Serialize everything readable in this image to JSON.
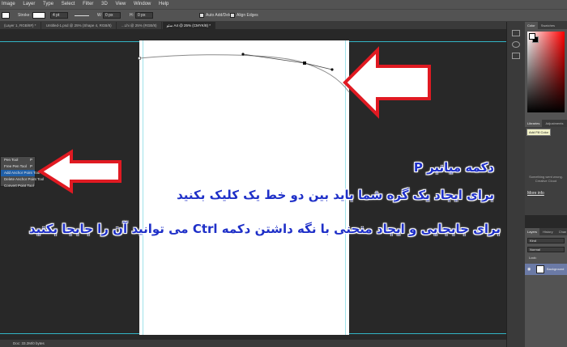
{
  "menu": [
    "Image",
    "Layer",
    "Type",
    "Select",
    "Filter",
    "3D",
    "View",
    "Window",
    "Help"
  ],
  "options_bar": {
    "stroke_label": "Stroke:",
    "stroke_width": "4 pt",
    "w_label": "W:",
    "w_value": "0 px",
    "h_label": "H:",
    "h_value": "0 px",
    "auto_add_delete": "Auto Add/Delete",
    "align_edges": "Align Edges"
  },
  "document_tabs": [
    {
      "label": "(Layer 1, RGB/8#) *",
      "active": false
    },
    {
      "label": "Untitled-1.psd @ 25% (Shape 4, RGB/8)",
      "active": false
    },
    {
      "label": "...Lhi @ 25% (RGB/8)",
      "active": false
    },
    {
      "label": "سئو A4 @ 25% (CMYK/8) *",
      "active": true
    }
  ],
  "status": {
    "doc_size": "Doc: 33.2M/0 bytes"
  },
  "tool_flyout": {
    "items": [
      {
        "label": "Pen Tool",
        "key": "P",
        "selected": false
      },
      {
        "label": "Free Pen Tool",
        "key": "P",
        "selected": false
      },
      {
        "label": "Add Anchor Point Tool",
        "key": "",
        "selected": true
      },
      {
        "label": "Delete Anchor Point Tool",
        "key": "",
        "selected": false
      },
      {
        "label": "Convert Point Tool",
        "key": "",
        "selected": false
      }
    ]
  },
  "annotations": {
    "title": "دکمه میانبر P",
    "line1": "برای ایجاد یک گره شما باید بین دو خط یک کلیک بکنید",
    "line2": "برای جابجایی و ایجاد منحنی با نگه داشتن دکمه Ctrl می توانید آن را جابجا بکنید"
  },
  "panels": {
    "color_tabs": [
      "Color",
      "Swatches"
    ],
    "libraries_tabs": [
      "Libraries",
      "Adjustments"
    ],
    "tooltip": "Add Fill Color",
    "libraries_text": "Something went wrong. Creative Cloud",
    "libraries_link": "More info",
    "layers_tabs": [
      "Layers",
      "History",
      "Chan"
    ],
    "kind_filter": "Kind",
    "blend_mode": "Normal",
    "lock_label": "Lock:",
    "layer_name": "Background"
  },
  "colors": {
    "accent_blue": "#1f30c8",
    "arrow_red": "#e01a22",
    "guide_cyan": "#33b5c5",
    "selection_blue": "#1f5fa8"
  }
}
